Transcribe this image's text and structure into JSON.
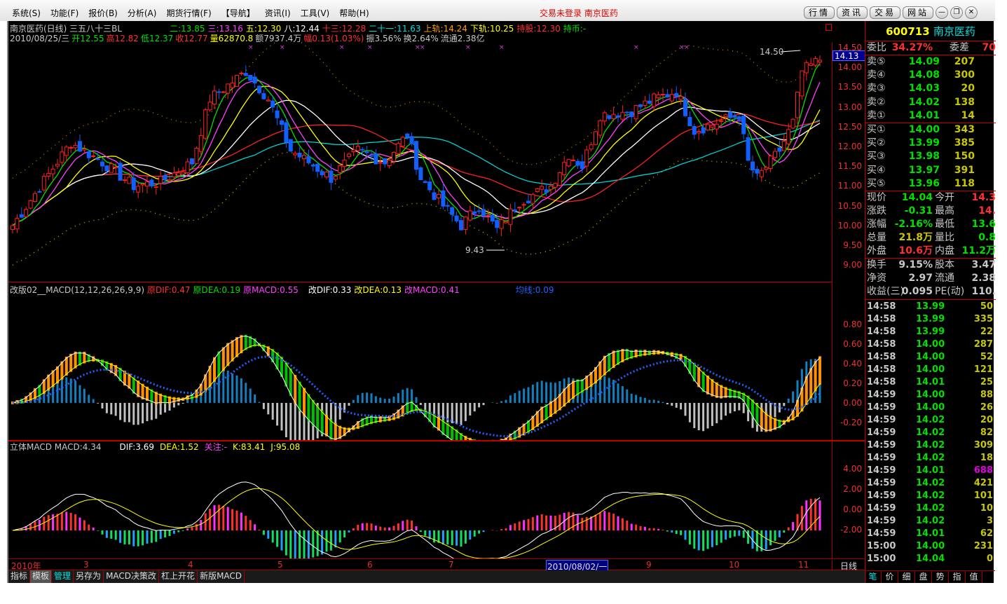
{
  "menu": [
    "系统(S)",
    "功能(F)",
    "报价(B)",
    "分析(A)",
    "期货行情(F)",
    "【导航】",
    "资讯(I)",
    "工具(V)",
    "帮助(H)"
  ],
  "notice": "交易未登录 南京医药",
  "window_buttons": [
    "行情",
    "资讯",
    "交易",
    "网站"
  ],
  "window_controls": [
    "—",
    "❐",
    "✕"
  ],
  "header": {
    "title": "南京医药(日线) 三五八十三BL",
    "ma": [
      {
        "t": "二:13.85",
        "c": "#00e000"
      },
      {
        "t": "三:13.16",
        "c": "#ff40ff"
      },
      {
        "t": "五:12.30",
        "c": "#ffff00"
      },
      {
        "t": "八:12.44",
        "c": "#ffffff"
      },
      {
        "t": "十三:12.28",
        "c": "#ff3030"
      },
      {
        "t": "二十一:11.63",
        "c": "#00e0e0"
      },
      {
        "t": "上轨:14.24",
        "c": "#ffa000"
      },
      {
        "t": "下轨:10.25",
        "c": "#ffff00"
      },
      {
        "t": "持股:12.30",
        "c": "#ff3030"
      },
      {
        "t": "持币:-",
        "c": "#00e000"
      }
    ],
    "line2": [
      {
        "t": "2010/08/25/三",
        "c": "#c8c8c8"
      },
      {
        "t": "开12.55",
        "c": "#00e000"
      },
      {
        "t": "高12.82",
        "c": "#ff3030"
      },
      {
        "t": "低12.37",
        "c": "#00e000"
      },
      {
        "t": "收12.77",
        "c": "#ff3030"
      },
      {
        "t": "量62870.8",
        "c": "#ffff00"
      },
      {
        "t": "额7937.4万",
        "c": "#c8c8c8"
      },
      {
        "t": "幅0.13(1.03%)",
        "c": "#ff3030"
      },
      {
        "t": "振3.56%",
        "c": "#c8c8c8"
      },
      {
        "t": "换2.64%",
        "c": "#c8c8c8"
      },
      {
        "t": "流通2.38亿",
        "c": "#c8c8c8"
      }
    ]
  },
  "annotations": {
    "high": "14.50",
    "low": "9.43",
    "cursor_price": "14.13"
  },
  "price_axis": [
    "14.50",
    "14.00",
    "13.50",
    "13.00",
    "12.50",
    "12.00",
    "11.50",
    "11.00",
    "10.50",
    "10.00",
    "9.50",
    "9.00"
  ],
  "macd1": {
    "label": [
      {
        "t": "改版02__MACD(12,12,26,26,9,9)",
        "c": "#c8c8c8"
      },
      {
        "t": "原DIF:0.47",
        "c": "#ff3030"
      },
      {
        "t": "原DEA:0.19",
        "c": "#00e000"
      },
      {
        "t": "原MACD:0.55",
        "c": "#ff40ff"
      },
      {
        "t": "改DIF:0.33",
        "c": "#ffffff"
      },
      {
        "t": "改DEA:0.13",
        "c": "#ffff00"
      },
      {
        "t": "改MACD:0.41",
        "c": "#ff40ff"
      },
      {
        "t": "均线:0.09",
        "c": "#2060ff"
      }
    ],
    "axis": [
      "0.80",
      "0.60",
      "0.40",
      "0.20",
      "0.00",
      "-0.20"
    ]
  },
  "macd2": {
    "label": [
      {
        "t": "立体MACD  MACD:4.34",
        "c": "#c8c8c8"
      },
      {
        "t": "DIF:3.69",
        "c": "#ffffff"
      },
      {
        "t": "DEA:1.52",
        "c": "#ffff00"
      },
      {
        "t": "关注:-",
        "c": "#ff40ff"
      },
      {
        "t": "K:83.41",
        "c": "#ffff00"
      },
      {
        "t": "J:95.08",
        "c": "#ffff00"
      }
    ],
    "axis": [
      "4.00",
      "2.00",
      "0.00",
      "-2.00"
    ]
  },
  "xaxis": {
    "labels": [
      "2010年",
      "3",
      "4",
      "5",
      "6",
      "7",
      "9",
      "10",
      "11"
    ],
    "cursor_date": "2010/08/02/一",
    "period": "日线"
  },
  "bottom_tabs": [
    "指标",
    "模板",
    "管理",
    "另存为",
    "MACD决策改",
    "杠上开花",
    "新版MACD"
  ],
  "quote": {
    "code": "600713",
    "name": "南京医药",
    "weibi_label": "委比",
    "weibi": "34.27%",
    "weicha_label": "委差",
    "weicha": "70",
    "sell": [
      [
        "卖⑤",
        "14.09",
        "207"
      ],
      [
        "卖④",
        "14.08",
        "300"
      ],
      [
        "卖③",
        "14.03",
        "20"
      ],
      [
        "卖②",
        "14.02",
        "138"
      ],
      [
        "卖①",
        "14.01",
        "14"
      ]
    ],
    "buy": [
      [
        "买①",
        "14.00",
        "343"
      ],
      [
        "买②",
        "13.99",
        "385"
      ],
      [
        "买③",
        "13.98",
        "150"
      ],
      [
        "买④",
        "13.97",
        "391"
      ],
      [
        "买⑤",
        "13.96",
        "118"
      ]
    ],
    "stats": [
      [
        "现价",
        "14.04",
        "今开",
        "14.3"
      ],
      [
        "涨跌",
        "-0.31",
        "最高",
        "14."
      ],
      [
        "涨幅",
        "-2.16%",
        "最低",
        "13.6"
      ],
      [
        "总量",
        "21.8万",
        "量比",
        "0.8"
      ],
      [
        "外盘",
        "10.6万",
        "内盘",
        "11.2万"
      ]
    ],
    "stats2": [
      [
        "换手",
        "9.15%",
        "股本",
        "3.47"
      ],
      [
        "净资",
        "2.97",
        "流通",
        "2.38"
      ],
      [
        "收益(三)",
        "0.095",
        "PE(动)",
        "110."
      ]
    ]
  },
  "ticks": [
    [
      "14:58",
      "13.99",
      "50"
    ],
    [
      "14:58",
      "13.99",
      "335"
    ],
    [
      "14:58",
      "13.99",
      "22"
    ],
    [
      "14:58",
      "14.00",
      "287"
    ],
    [
      "14:58",
      "14.00",
      "52"
    ],
    [
      "14:58",
      "14.00",
      "121"
    ],
    [
      "14:58",
      "14.01",
      "25"
    ],
    [
      "14:59",
      "14.00",
      "88"
    ],
    [
      "14:59",
      "14.00",
      "26"
    ],
    [
      "14:59",
      "14.02",
      "20"
    ],
    [
      "14:59",
      "14.02",
      "82"
    ],
    [
      "14:59",
      "14.02",
      "309"
    ],
    [
      "14:59",
      "14.02",
      "18"
    ],
    [
      "14:59",
      "14.01",
      "688"
    ],
    [
      "14:59",
      "14.02",
      "421"
    ],
    [
      "14:59",
      "14.02",
      "101"
    ],
    [
      "14:59",
      "14.02",
      "10"
    ],
    [
      "14:59",
      "14.02",
      "3"
    ],
    [
      "14:59",
      "14.01",
      "62"
    ],
    [
      "15:00",
      "14.00",
      "231"
    ],
    [
      "15:00",
      "14.04",
      "0"
    ]
  ],
  "right_tabs": [
    "笔",
    "价",
    "细",
    "盘",
    "势",
    "指",
    "值"
  ],
  "chart_data": {
    "type": "candlestick",
    "ylim": [
      9.0,
      14.5
    ],
    "close_waypoints": [
      [
        0,
        10.0
      ],
      [
        13,
        12.1
      ],
      [
        20,
        11.6
      ],
      [
        27,
        11.0
      ],
      [
        33,
        11.1
      ],
      [
        40,
        11.6
      ],
      [
        44,
        13.2
      ],
      [
        52,
        13.9
      ],
      [
        57,
        13.2
      ],
      [
        62,
        11.9
      ],
      [
        66,
        11.6
      ],
      [
        71,
        11.2
      ],
      [
        77,
        11.9
      ],
      [
        83,
        11.6
      ],
      [
        88,
        12.3
      ],
      [
        91,
        11.2
      ],
      [
        96,
        10.5
      ],
      [
        100,
        10.0
      ],
      [
        104,
        10.5
      ],
      [
        108,
        9.9
      ],
      [
        113,
        10.6
      ],
      [
        120,
        11.0
      ],
      [
        124,
        11.8
      ],
      [
        127,
        11.5
      ],
      [
        131,
        12.8
      ],
      [
        138,
        12.9
      ],
      [
        143,
        13.2
      ],
      [
        148,
        13.4
      ],
      [
        152,
        12.4
      ],
      [
        157,
        12.6
      ],
      [
        162,
        12.8
      ],
      [
        164,
        11.6
      ],
      [
        166,
        11.2
      ],
      [
        171,
        11.9
      ],
      [
        174,
        12.6
      ],
      [
        176,
        13.9
      ],
      [
        180,
        14.2
      ]
    ],
    "colors": {
      "up": "#ff2020",
      "down": "#1060ff"
    }
  }
}
